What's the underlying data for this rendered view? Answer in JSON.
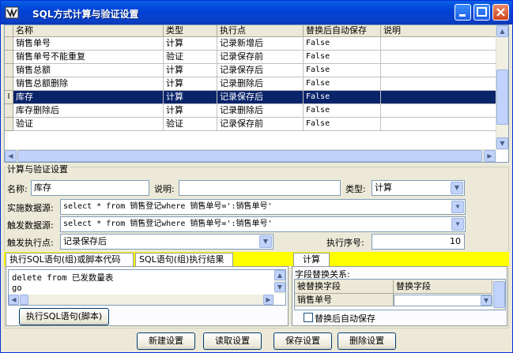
{
  "window": {
    "title": "SQL方式计算与验证设置"
  },
  "grid": {
    "headers": [
      "名称",
      "类型",
      "执行点",
      "替换后自动保存",
      "说明"
    ],
    "rows": [
      {
        "name": "销售单号",
        "type": "计算",
        "point": "记录新增后",
        "autosave": "False",
        "desc": ""
      },
      {
        "name": "销售单号不能重复",
        "type": "验证",
        "point": "记录保存前",
        "autosave": "False",
        "desc": ""
      },
      {
        "name": "销售总额",
        "type": "计算",
        "point": "记录保存后",
        "autosave": "False",
        "desc": ""
      },
      {
        "name": "销售总额删除",
        "type": "计算",
        "point": "记录删除后",
        "autosave": "False",
        "desc": ""
      },
      {
        "name": "库存",
        "type": "计算",
        "point": "记录保存后",
        "autosave": "False",
        "desc": ""
      },
      {
        "name": "库存删除后",
        "type": "计算",
        "point": "记录删除后",
        "autosave": "False",
        "desc": ""
      },
      {
        "name": "验证",
        "type": "验证",
        "point": "记录保存前",
        "autosave": "False",
        "desc": ""
      }
    ],
    "selected_index": 4,
    "current_marker": "I"
  },
  "settings": {
    "group_label": "计算与验证设置",
    "name_label": "名称:",
    "name_value": "库存",
    "desc_label": "说明:",
    "desc_value": "",
    "type_label": "类型:",
    "type_value": "计算",
    "impl_source_label": "实施数据源:",
    "impl_source_value": "select * from 销售登记where 销售单号=':销售单号'",
    "trigger_source_label": "触发数据源:",
    "trigger_source_value": "select * from 销售登记where 销售单号=':销售单号'",
    "trigger_point_label": "触发执行点:",
    "trigger_point_value": "记录保存后",
    "order_label": "执行序号:",
    "order_value": "10"
  },
  "tabs": {
    "left": [
      "执行SQL语句(组)或脚本代码",
      "SQL语句(组)执行结果"
    ],
    "right": [
      "计算"
    ]
  },
  "editor": {
    "lines": [
      "delete from 已发数量表",
      "go"
    ]
  },
  "run_button": "执行SQL语句(脚本)",
  "replace": {
    "label": "字段替换关系:",
    "col1": "被替换字段",
    "col2": "替换字段",
    "row_field": "销售单号",
    "row_value": "",
    "autosave_label": "替换后自动保存",
    "autosave_checked": false
  },
  "buttons": {
    "new": "新建设置",
    "read": "读取设置",
    "save": "保存设置",
    "delete": "删除设置"
  },
  "colors": {
    "titlebar": "#0a5fe6",
    "selection": "#0a246a",
    "tab_strip": "#ffff00"
  }
}
